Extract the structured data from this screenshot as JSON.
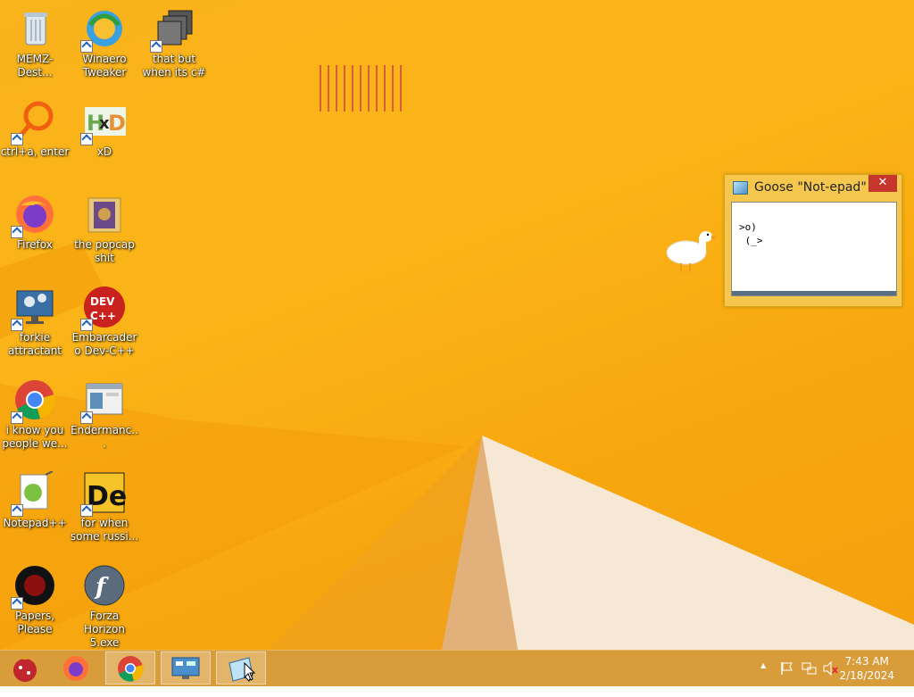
{
  "desktop": {
    "icons": [
      {
        "label": "MEMZ-Dest...",
        "icon": "recycle-bin-icon"
      },
      {
        "label": "Winaero Tweaker",
        "icon": "winaero-icon"
      },
      {
        "label": "that but when its c#",
        "icon": "stacked-windows-icon"
      },
      {
        "label": "ctrl+a, enter",
        "icon": "magnifier-icon"
      },
      {
        "label": "xD",
        "icon": "hxd-icon"
      },
      {
        "label": "Firefox",
        "icon": "firefox-icon"
      },
      {
        "label": "the popcap shit",
        "icon": "folder-icon"
      },
      {
        "label": "forkie attractant",
        "icon": "monitor-gear-icon"
      },
      {
        "label": "Embarcadero Dev-C++",
        "icon": "dev-cpp-icon"
      },
      {
        "label": "i know you people we...",
        "icon": "chrome-icon"
      },
      {
        "label": "Endermanc...",
        "icon": "window-app-icon"
      },
      {
        "label": "Notepad++",
        "icon": "notepadpp-icon"
      },
      {
        "label": "for when some russi...",
        "icon": "de-icon"
      },
      {
        "label": "Papers, Please",
        "icon": "papers-please-icon"
      },
      {
        "label": "Forza Horizon 5.exe",
        "icon": "flash-icon"
      }
    ]
  },
  "notepad_window": {
    "title": "Goose \"Not-epad\"",
    "close_glyph": "✕",
    "text": ">o)\n (_>"
  },
  "taskbar": {
    "items": [
      "start-ornament-icon",
      "firefox-icon",
      "chrome-icon",
      "control-panel-icon",
      "notepad-icon"
    ]
  },
  "tray": {
    "up_arrow": "▲",
    "time": "7:43 AM",
    "date": "2/18/2024"
  },
  "colors": {
    "desktop_bg": "#f9b31b",
    "taskbar_bg": "#d89c3a",
    "close_red": "#c7362d"
  }
}
